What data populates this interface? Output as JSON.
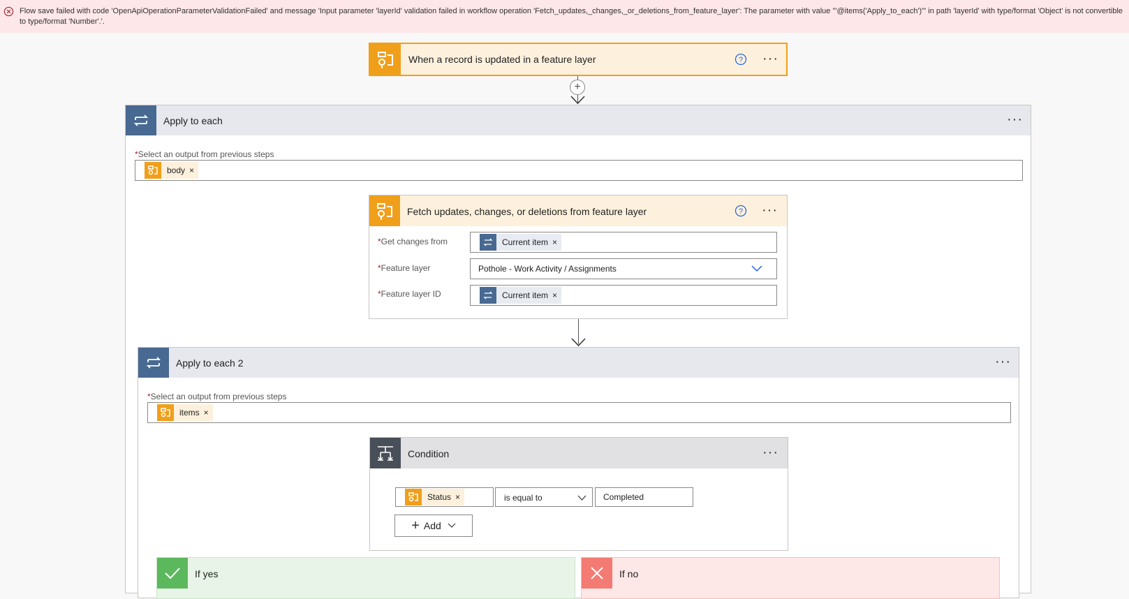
{
  "error": {
    "message": "Flow save failed with code 'OpenApiOperationParameterValidationFailed' and message 'Input parameter 'layerId' validation failed in workflow operation 'Fetch_updates,_changes,_or_deletions_from_feature_layer': The parameter with value '\"@items('Apply_to_each')\"' in path 'layerId' with type/format 'Object' is not convertible to type/format 'Number'.'.",
    "icon": "error-circle-icon"
  },
  "trigger": {
    "title": "When a record is updated in a feature layer",
    "help_icon": "help-circle-icon",
    "more": "···"
  },
  "add_step": "+",
  "apply1": {
    "title": "Apply to each",
    "more": "···",
    "select_label": "Select an output from previous steps",
    "token": "body"
  },
  "fetch": {
    "title": "Fetch updates, changes, or deletions from feature layer",
    "more": "···",
    "fields": [
      {
        "label": "Get changes from",
        "token": "Current item"
      },
      {
        "label": "Feature layer",
        "value": "Pothole - Work Activity / Assignments"
      },
      {
        "label": "Feature layer ID",
        "token": "Current item"
      }
    ]
  },
  "apply2": {
    "title": "Apply to each 2",
    "more": "···",
    "select_label": "Select an output from previous steps",
    "token": "items"
  },
  "condition": {
    "title": "Condition",
    "more": "···",
    "left_token": "Status",
    "operator": "is equal to",
    "right_value": "Completed",
    "add_label": "Add"
  },
  "branches": {
    "yes_label": "If yes",
    "no_label": "If no"
  },
  "token_remove": "×",
  "required_mark": "*",
  "colors": {
    "error_bg": "#fde7e9",
    "connector_orange": "#f09f1b",
    "loop_blue": "#486991",
    "condition_dark": "#484f58",
    "yes_green": "#5cb85c",
    "no_red": "#f37b73"
  }
}
